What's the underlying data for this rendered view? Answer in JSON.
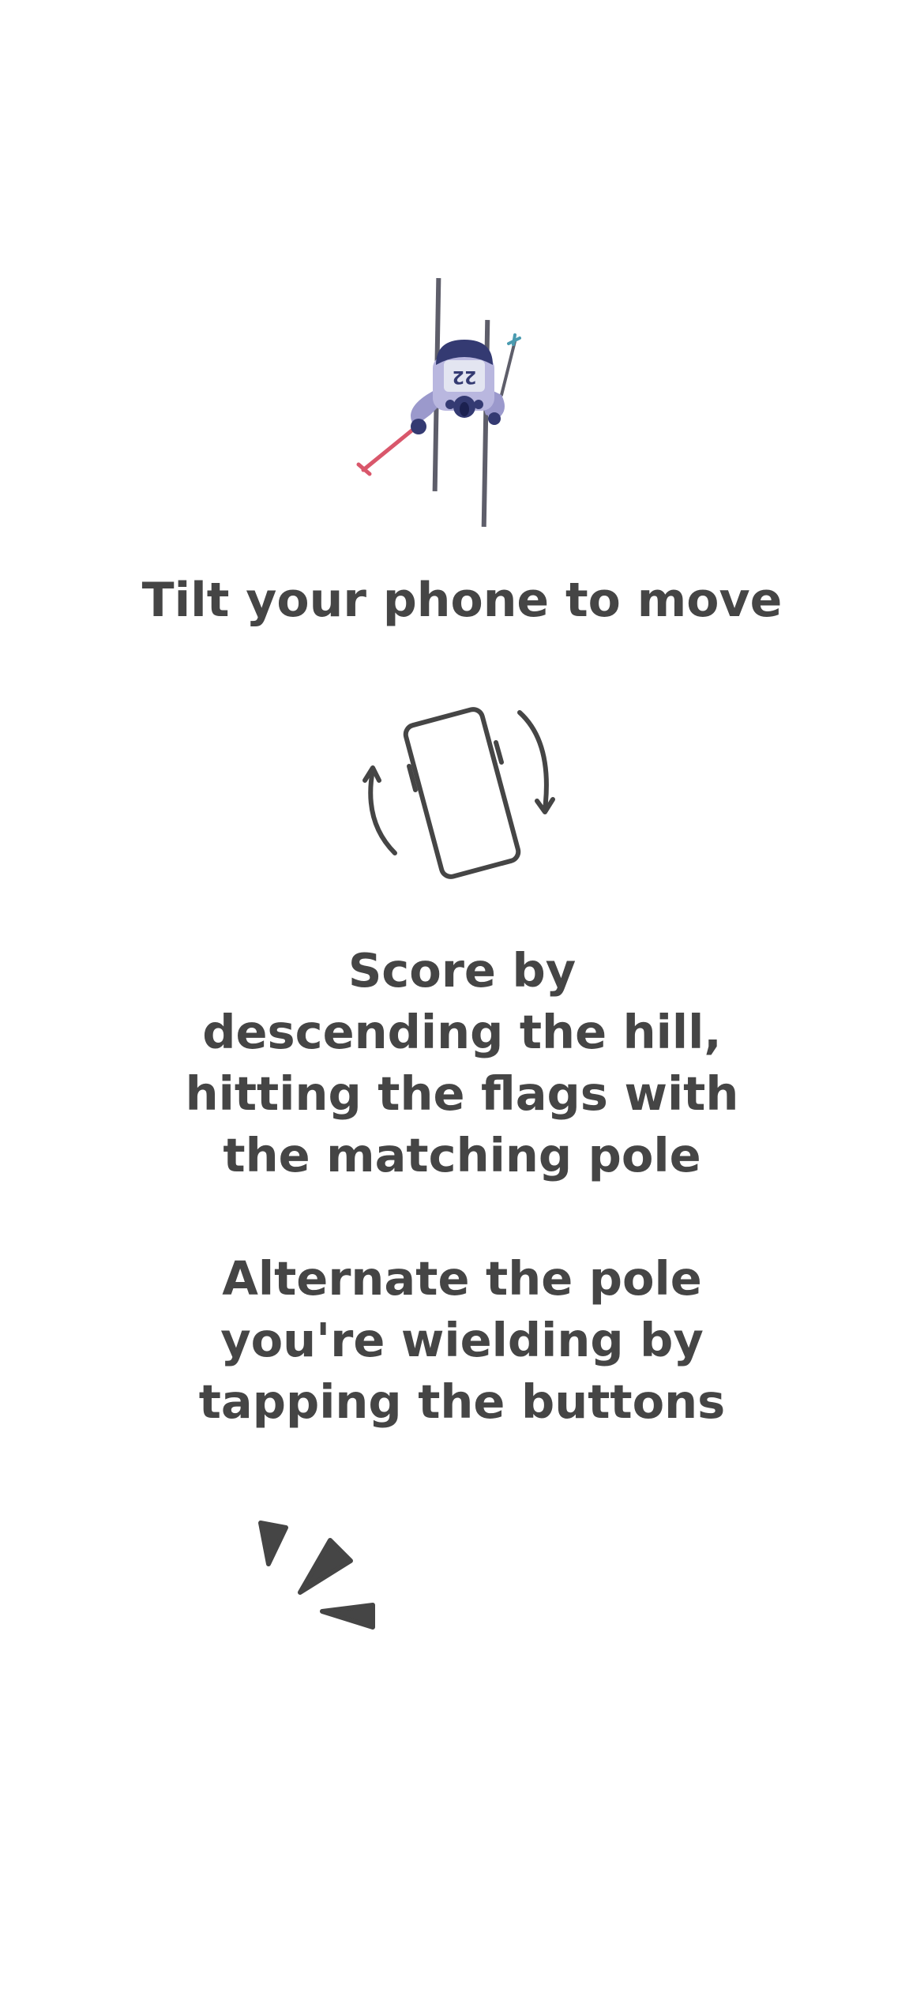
{
  "skier": {
    "bib_number": "22",
    "colors": {
      "body": "#9b99cc",
      "helmet": "#343a72",
      "pole_left": "#d9576b",
      "pole_right": "#4a9bb0",
      "skis": "#5e5e6a"
    }
  },
  "tutorial": {
    "tilt_title": "Tilt your phone to move",
    "score_text": "Score by\ndescending the hill,\nhitting the flags with\nthe matching pole",
    "alternate_text": "Alternate the pole\nyou're wielding by\ntapping the buttons"
  },
  "icons": {
    "phone_tilt": "phone-tilt-icon",
    "tap": "tap-burst-icon"
  },
  "colors": {
    "text": "#454545",
    "background": "#ffffff"
  }
}
